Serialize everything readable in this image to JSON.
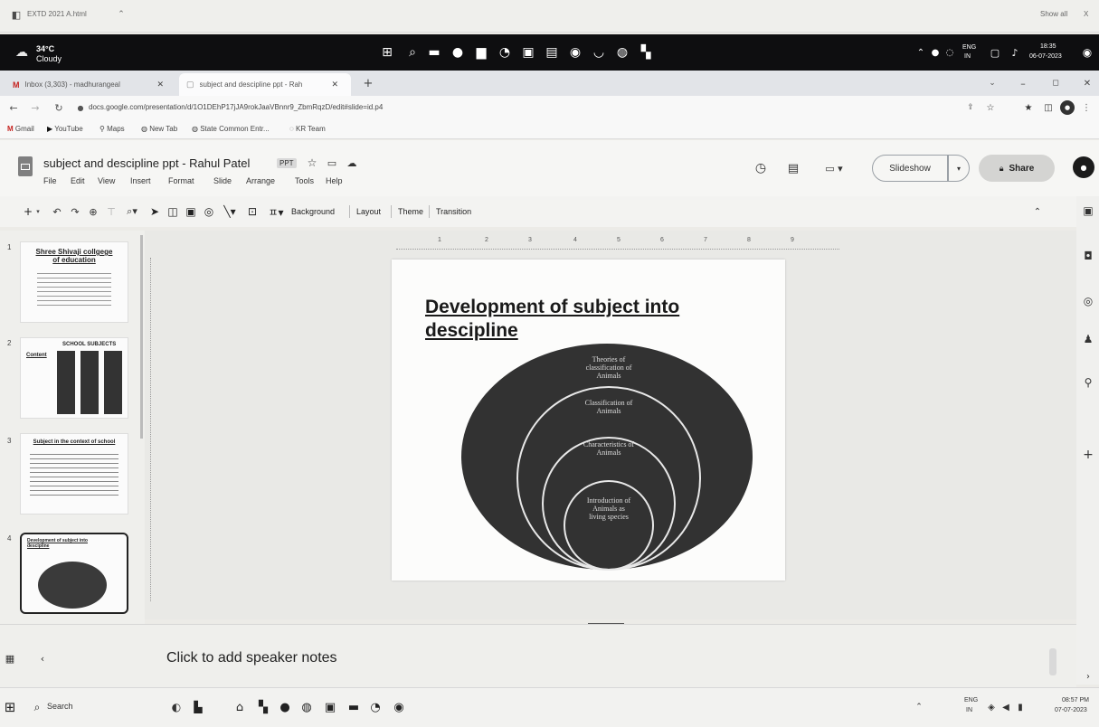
{
  "download_bar": {
    "file": "EXTD 2021 A.html",
    "show_all": "Show all",
    "close": "X"
  },
  "system": {
    "weather_temp": "34°C",
    "weather_cond": "Cloudy",
    "lang": "ENG",
    "region": "IN",
    "time": "18:35",
    "date": "06-07-2023"
  },
  "tabs": [
    {
      "label": "Inbox (3,303) - madhurangeal"
    },
    {
      "label": "subject and descipline ppt - Rah"
    }
  ],
  "address": {
    "url": "docs.google.com/presentation/d/1O1DEhP17jJA9rokJaaVBnnr9_ZbmRqzD/edit#slide=id.p4"
  },
  "bookmarks": [
    "Gmail",
    "YouTube",
    "Maps",
    "New Tab",
    "State Common Entr...",
    "KR Team"
  ],
  "doc": {
    "title": "subject and descipline ppt - Rahul Patel",
    "badge": "PPT",
    "menu": [
      "File",
      "Edit",
      "View",
      "Insert",
      "Format",
      "Slide",
      "Arrange",
      "Tools",
      "Help"
    ],
    "slideshow": "Slideshow",
    "share": "Share"
  },
  "toolbar": {
    "background": "Background",
    "layout": "Layout",
    "theme": "Theme",
    "transition": "Transition"
  },
  "ruler_ticks": [
    "1",
    "2",
    "3",
    "4",
    "5",
    "6",
    "7",
    "8",
    "9"
  ],
  "thumbs": [
    {
      "num": "1",
      "title": "Shree Shivaji collgege of education"
    },
    {
      "num": "2",
      "title": "SCHOOL SUBJECTS",
      "sub": "Content"
    },
    {
      "num": "3",
      "title": "Subject in the context of school"
    },
    {
      "num": "4",
      "title": "Development of subject into descipline"
    }
  ],
  "slide": {
    "title_line1": "Development of subject into",
    "title_line2": "descipline",
    "rings": [
      "Theories of classification of Animals",
      "Classification of Animals",
      "Characteristics of Animals",
      "Introduction of Animals as living species"
    ]
  },
  "notes": {
    "placeholder": "Click to add speaker notes"
  },
  "taskbar": {
    "search": "Search",
    "lang": "ENG",
    "region": "IN",
    "time": "08:57 PM",
    "date": "07-07-2023"
  }
}
